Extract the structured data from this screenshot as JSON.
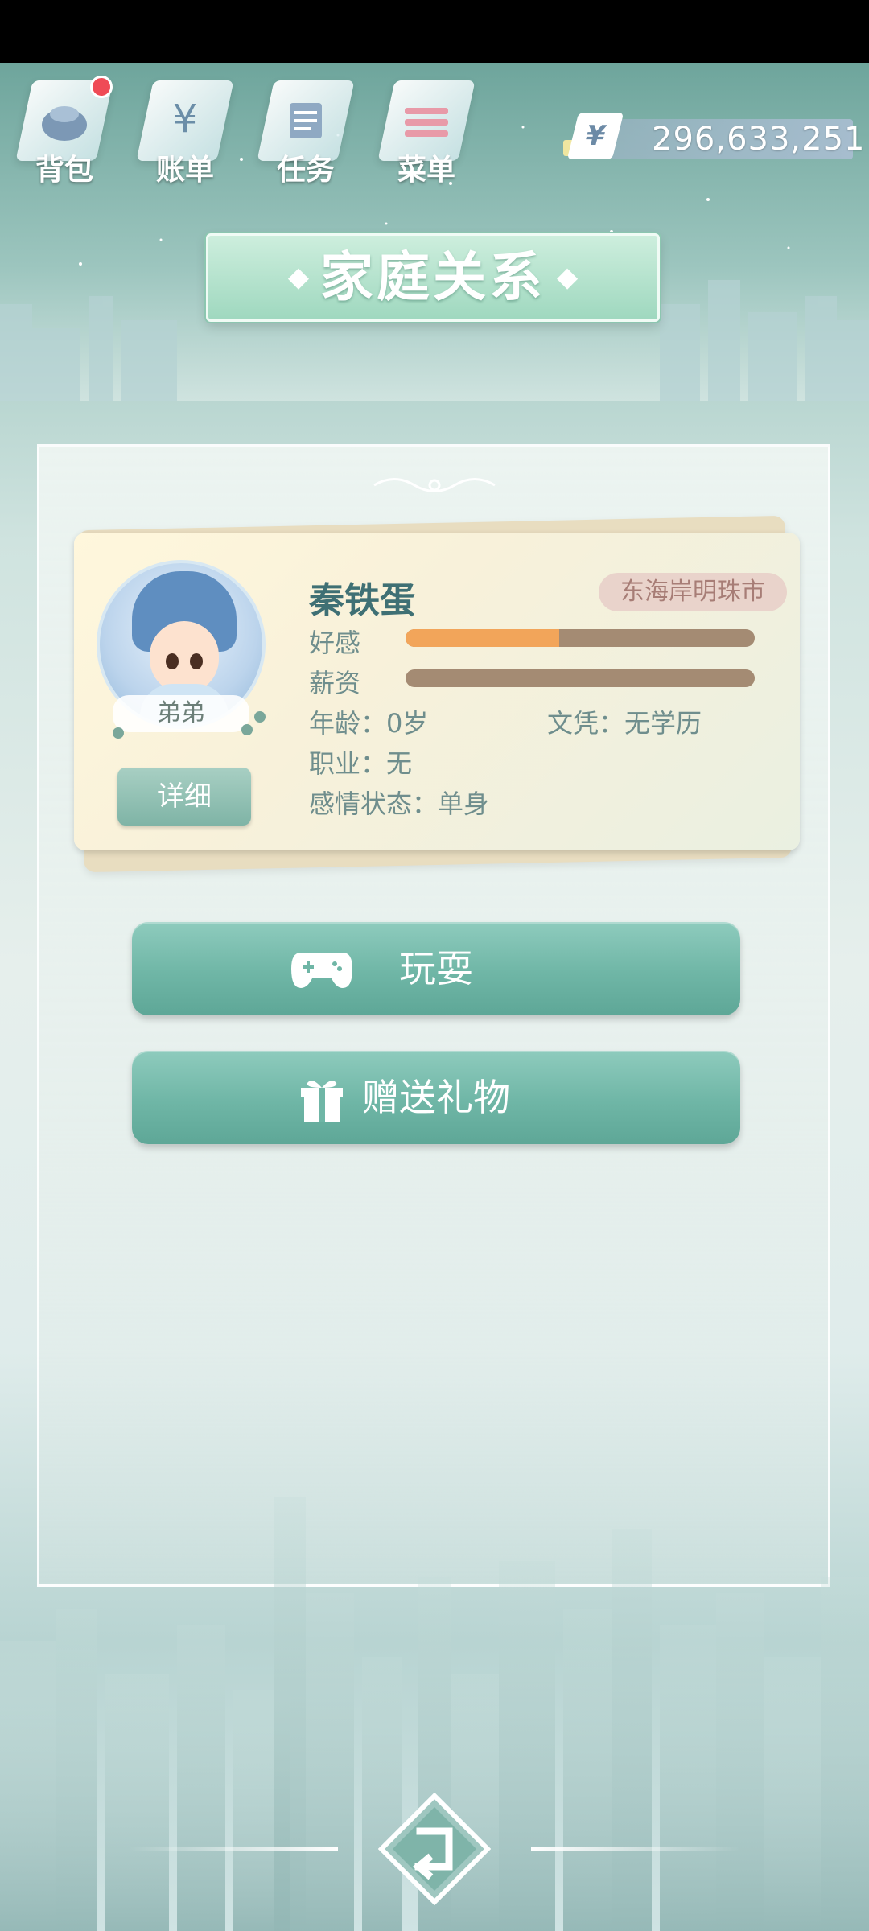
{
  "nav": {
    "items": [
      {
        "label": "背包",
        "icon": "backpack-icon",
        "badge": true
      },
      {
        "label": "账单",
        "icon": "bill-icon",
        "glyph": "¥"
      },
      {
        "label": "任务",
        "icon": "task-icon"
      },
      {
        "label": "菜单",
        "icon": "menu-icon"
      }
    ]
  },
  "currency": {
    "symbol": "¥",
    "value": "296,633,251"
  },
  "title": "家庭关系",
  "card": {
    "name": "秦铁蛋",
    "location": "东海岸明珠市",
    "relation": "弟弟",
    "detail_label": "详细",
    "favor_label": "好感",
    "salary_label": "薪资",
    "favor_level": 0.44,
    "salary_level": 0.0,
    "age": "年龄：0岁",
    "education": "文凭：无学历",
    "job": "职业：无",
    "relationship": "感情状态：单身"
  },
  "actions": {
    "play_label": "玩耍",
    "gift_label": "赠送礼物"
  },
  "colors": {
    "accent": "#6fb6a6",
    "name": "#3f7074",
    "favor": "#f2a55a",
    "track": "#a48b73"
  }
}
